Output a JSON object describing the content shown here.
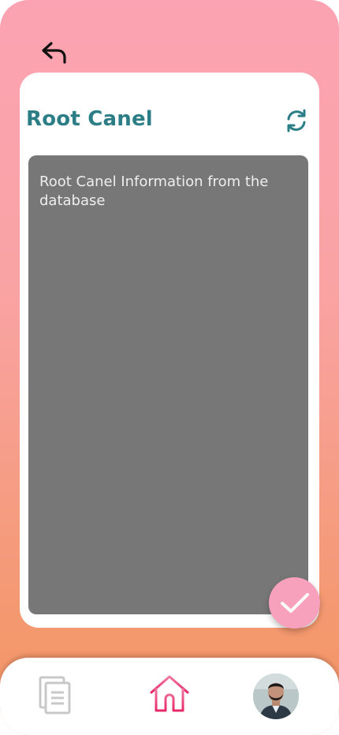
{
  "header": {
    "back_icon": "undo-arrow-icon"
  },
  "card": {
    "title": "Root Canel",
    "refresh_icon": "refresh-icon",
    "info_text": "Root Canel Information from the database"
  },
  "fab": {
    "icon": "check-icon",
    "color": "#f7a1bc"
  },
  "bottom_nav": {
    "items": [
      {
        "icon": "documents-icon"
      },
      {
        "icon": "home-icon",
        "active": true
      },
      {
        "icon": "profile-avatar"
      }
    ]
  },
  "colors": {
    "accent": "#2b7e86",
    "home_active": "#e8407a",
    "bg_top": "#fca3b3",
    "bg_bottom": "#f39567",
    "info_box": "#777777"
  }
}
